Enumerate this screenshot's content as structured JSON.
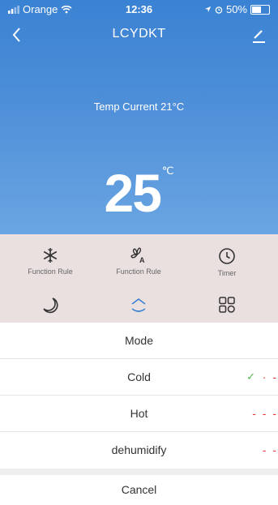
{
  "status_bar": {
    "carrier": "Orange",
    "time": "12:36",
    "battery": "50%",
    "battery_level": 0.5
  },
  "nav": {
    "title": "LCYDKT",
    "back_icon": "chevron-left-icon",
    "edit_icon": "pencil-icon"
  },
  "temperature": {
    "current_label": "Temp Current  21°C",
    "set_value": "25",
    "unit": "℃"
  },
  "controls": [
    {
      "label": "Function Rule",
      "icon": "snowflake-icon"
    },
    {
      "label": "Function Rule",
      "icon": "fan-auto-icon"
    },
    {
      "label": "Timer",
      "icon": "clock-icon"
    },
    {
      "label": "",
      "icon": "moon-icon"
    },
    {
      "label": "",
      "icon": "swing-icon"
    },
    {
      "label": "",
      "icon": "grid-icon"
    }
  ],
  "mode_sheet": {
    "title": "Mode",
    "options": [
      "Cold",
      "Hot",
      "dehumidify"
    ],
    "selected": "Cold",
    "cancel": "Cancel"
  },
  "colors": {
    "header_top": "#3a82d3",
    "accent_blue": "#3a82d3",
    "check_green": "#54b84f",
    "marker_red": "#e53935",
    "controls_bg": "#ebe0e0"
  }
}
